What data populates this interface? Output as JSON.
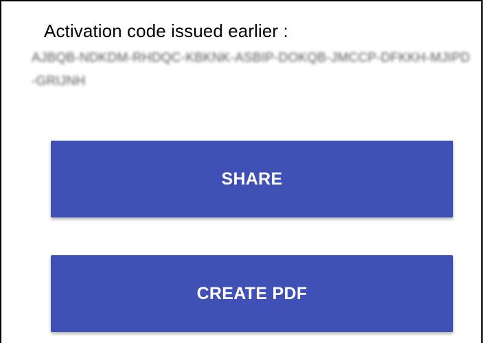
{
  "activation": {
    "title": "Activation code issued earlier :",
    "code": "AJBQB-NDKDM-RHDQC-KBKNK-ASBIP-DOKQB-JMCCP-DFKKH-MJIPD-GRIJNH"
  },
  "buttons": {
    "share_label": "SHARE",
    "create_pdf_label": "CREATE PDF"
  },
  "colors": {
    "button_bg": "#3f51b5",
    "button_text": "#ffffff"
  }
}
